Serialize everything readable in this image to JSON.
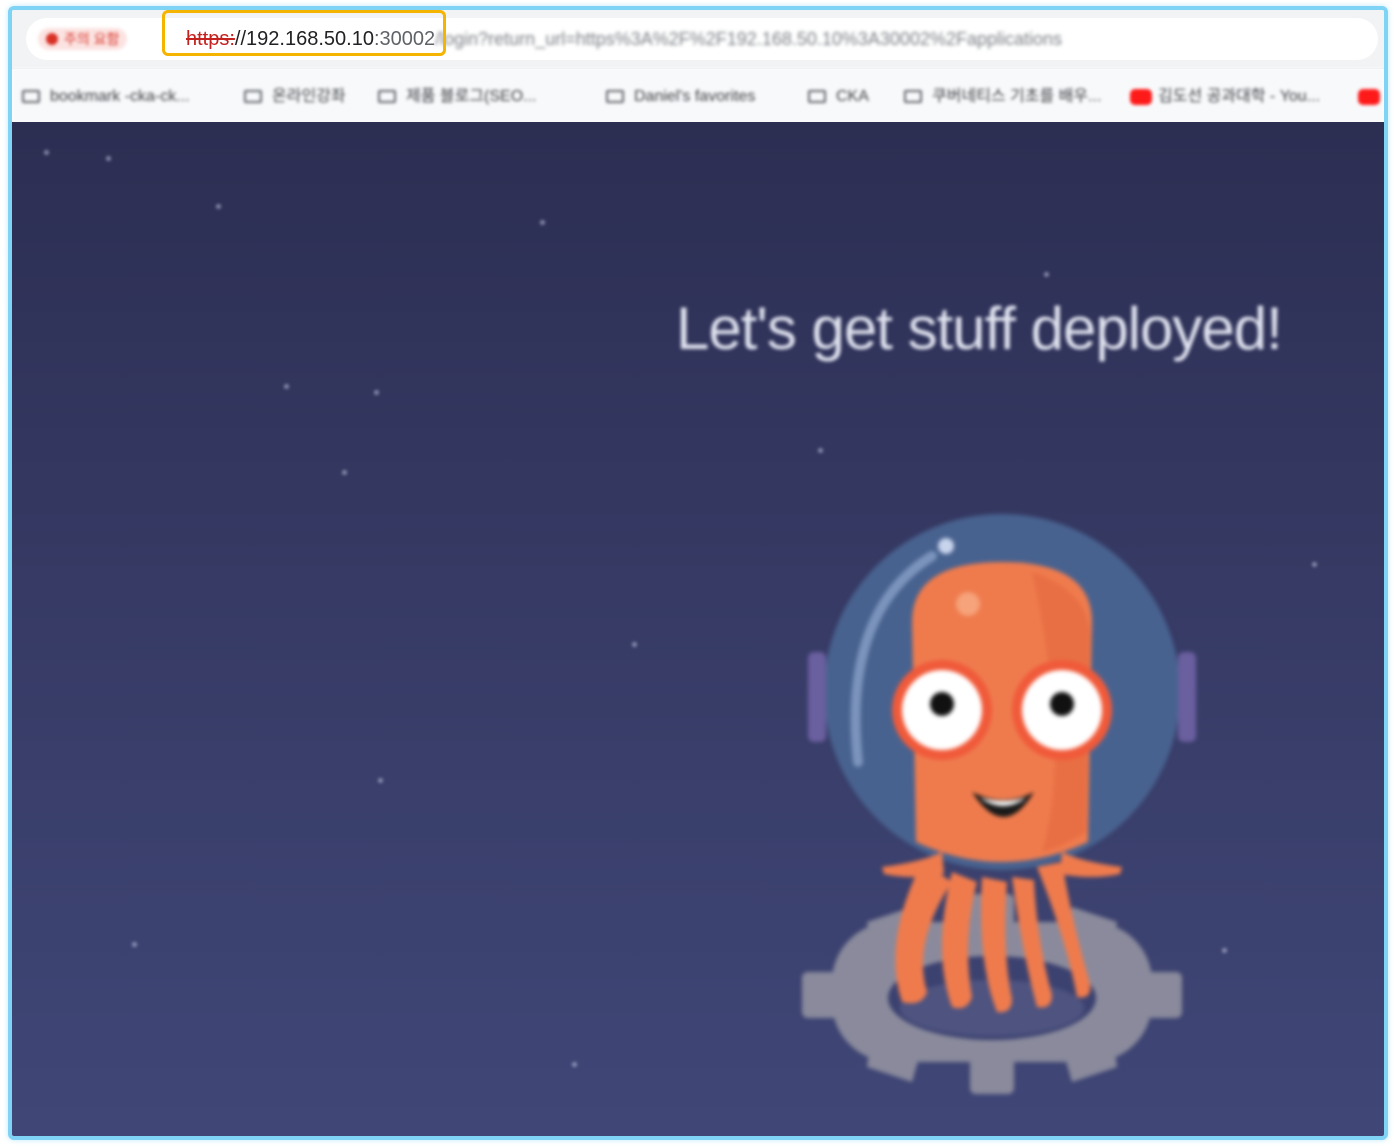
{
  "browser": {
    "security_chip": "주의 요함",
    "url": {
      "scheme": "https:",
      "separator": "//",
      "host": "192.168.50.10",
      "port": ":30002",
      "path": "/login?return_url=https%3A%2F%2F192.168.50.10%3A30002%2Fapplications"
    },
    "bookmarks": [
      {
        "label": "bookmark -cka-ck...",
        "icon": "folder-icon"
      },
      {
        "label": "온라인강좌",
        "icon": "folder-icon"
      },
      {
        "label": "제품 블로그(SEO...",
        "icon": "folder-icon"
      },
      {
        "label": "Daniel's favorites",
        "icon": "folder-icon"
      },
      {
        "label": "CKA",
        "icon": "folder-icon"
      },
      {
        "label": "쿠버네티스 기초를 배우...",
        "icon": "folder-icon"
      },
      {
        "label": "김도선 공과대학 - You...",
        "icon": "youtube-icon"
      },
      {
        "label": "",
        "icon": "youtube-icon"
      }
    ]
  },
  "page": {
    "headline": "Let's get stuff deployed!",
    "mascot": "argo-octopus-mascot",
    "colors": {
      "background_top": "#2c2e52",
      "background_bottom": "#404777",
      "mascot_orange": "#ef7b4d",
      "helmet_blue": "#48628f",
      "gear_gray": "#8a8a9c",
      "highlight_box": "#f5b400",
      "frame_border": "#7fd3f5"
    }
  }
}
